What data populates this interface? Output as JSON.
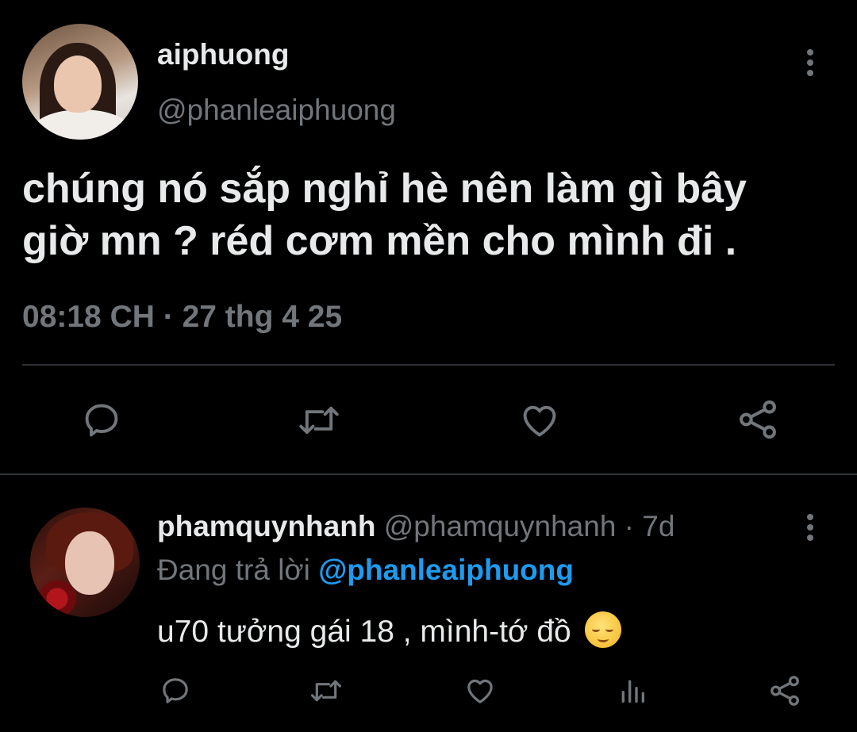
{
  "tweet": {
    "display_name": "aiphuong",
    "handle": "@phanleaiphuong",
    "text": "chúng nó sắp nghỉ hè nên làm gì bây giờ mn ? réd cơm mền cho mình đi .",
    "timestamp": "08:18 CH · 27 thg 4 25",
    "avatar_icon": "profile-photo",
    "actions": [
      "reply-icon",
      "retweet-icon",
      "like-icon",
      "share-icon"
    ]
  },
  "reply": {
    "display_name": "phamquynhanh",
    "meta": "@phamquynhanh · 7d",
    "replying_label": "Đang trả lời",
    "replying_handle": "@phanleaiphuong",
    "text": "u70 tưởng gái 18 , mình-tớ đồ",
    "emoji": "relieved-face",
    "actions": [
      "reply-icon",
      "retweet-icon",
      "like-icon",
      "views-icon",
      "share-icon"
    ]
  },
  "colors": {
    "background": "#000000",
    "text_primary": "#e7e9ea",
    "text_secondary": "#71767b",
    "link": "#1d9bf0",
    "divider": "#2f3336"
  }
}
